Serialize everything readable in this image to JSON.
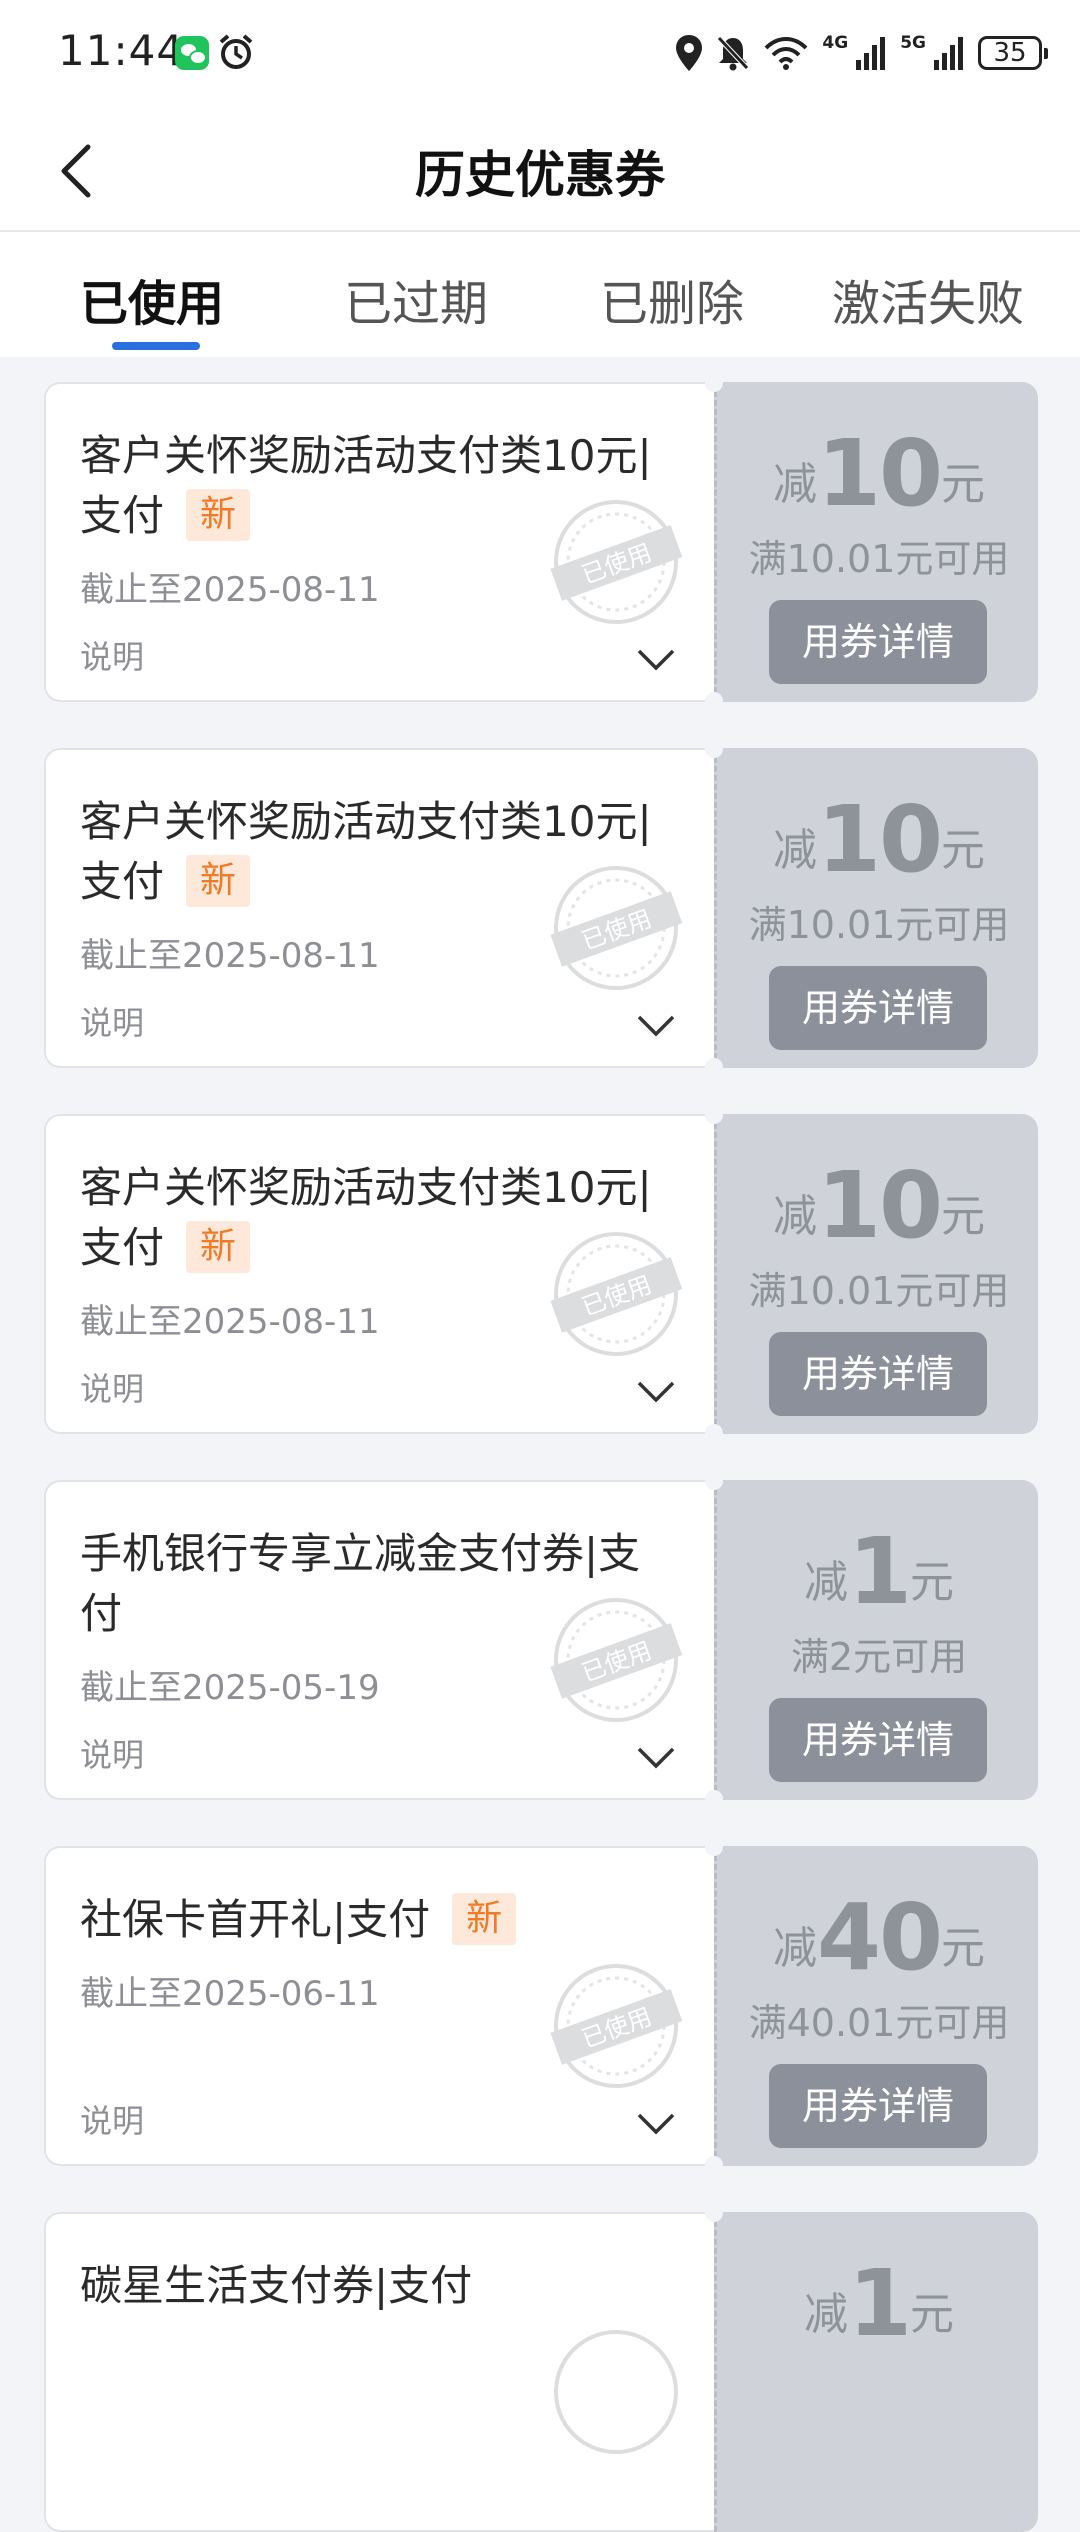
{
  "status_bar": {
    "time": "11:44",
    "battery": "35",
    "signal_4g": "4G",
    "signal_5g": "5G"
  },
  "header": {
    "title": "历史优惠券"
  },
  "tabs": [
    {
      "label": "已使用"
    },
    {
      "label": "已过期"
    },
    {
      "label": "已删除"
    },
    {
      "label": "激活失败"
    }
  ],
  "coupons": [
    {
      "title": "客户关怀奖励活动支付类10元|支付",
      "badge": "新",
      "expire": "截止至2025-08-11",
      "desc": "说明",
      "prefix": "减",
      "amount": "10",
      "unit": "元",
      "condition": "满10.01元可用",
      "button": "用券详情",
      "stamp": "已使用"
    },
    {
      "title": "客户关怀奖励活动支付类10元|支付",
      "badge": "新",
      "expire": "截止至2025-08-11",
      "desc": "说明",
      "prefix": "减",
      "amount": "10",
      "unit": "元",
      "condition": "满10.01元可用",
      "button": "用券详情",
      "stamp": "已使用"
    },
    {
      "title": "客户关怀奖励活动支付类10元|支付",
      "badge": "新",
      "expire": "截止至2025-08-11",
      "desc": "说明",
      "prefix": "减",
      "amount": "10",
      "unit": "元",
      "condition": "满10.01元可用",
      "button": "用券详情",
      "stamp": "已使用"
    },
    {
      "title": "手机银行专享立减金支付券|支付",
      "badge": "",
      "expire": "截止至2025-05-19",
      "desc": "说明",
      "prefix": "减",
      "amount": "1",
      "unit": "元",
      "condition": "满2元可用",
      "button": "用券详情",
      "stamp": "已使用"
    },
    {
      "title": "社保卡首开礼|支付",
      "badge": "新",
      "expire": "截止至2025-06-11",
      "desc": "说明",
      "prefix": "减",
      "amount": "40",
      "unit": "元",
      "condition": "满40.01元可用",
      "button": "用券详情",
      "stamp": "已使用"
    },
    {
      "title": "碳星生活支付券|支付",
      "badge": "",
      "expire": "",
      "desc": "",
      "prefix": "减",
      "amount": "1",
      "unit": "元",
      "condition": "",
      "button": "",
      "stamp": ""
    }
  ],
  "colors": {
    "accent": "#2a6fe0",
    "badge_text": "#f07a25",
    "badge_bg": "#fde8d9",
    "coupon_right_bg": "#cfd2d9",
    "button_bg": "#8b909a"
  },
  "icons": {
    "back": "back-arrow-icon",
    "expand": "chevron-down-icon",
    "location": "location-icon",
    "mute": "bell-off-icon",
    "wifi": "wifi-icon"
  }
}
